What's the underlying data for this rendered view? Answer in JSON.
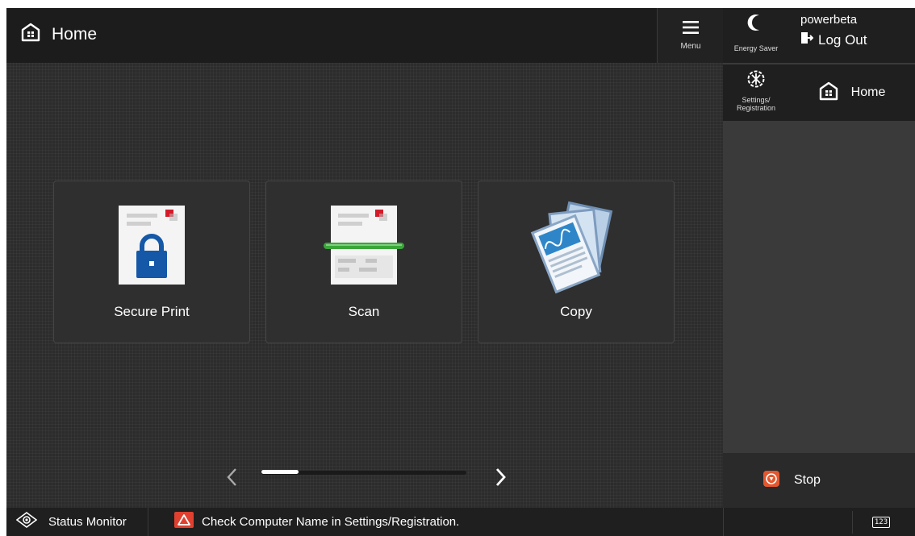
{
  "header": {
    "title": "Home",
    "menu_label": "Menu"
  },
  "tiles": [
    {
      "label": "Secure Print",
      "icon": "secure-print-icon"
    },
    {
      "label": "Scan",
      "icon": "scan-icon"
    },
    {
      "label": "Copy",
      "icon": "copy-icon"
    }
  ],
  "pager": {
    "current_page_fraction": 0.18
  },
  "right_panel": {
    "energy_saver_label": "Energy Saver",
    "username": "powerbeta",
    "logout_label": "Log Out",
    "settings_label_line1": "Settings/",
    "settings_label_line2": "Registration",
    "home_label": "Home",
    "stop_label": "Stop"
  },
  "bottom_bar": {
    "status_monitor_label": "Status Monitor",
    "message": "Check Computer Name in Settings/Registration.",
    "keyboard_label": "123"
  },
  "colors": {
    "background": "#2b2b2b",
    "topbar": "#1c1c1c",
    "accent_blue": "#1558a8",
    "scan_green": "#3aa63a",
    "stop_orange": "#e4572e",
    "warning_red": "#e0402f"
  }
}
